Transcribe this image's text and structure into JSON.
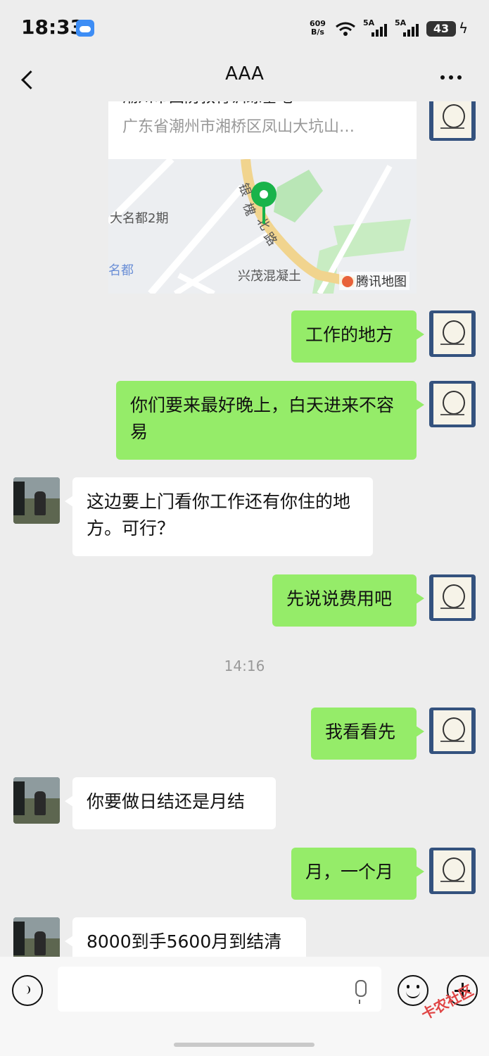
{
  "status_bar": {
    "time": "18:33",
    "net_speed_value": "609",
    "net_speed_unit": "B/s",
    "signal_1": "5A",
    "signal_2": "5A",
    "battery": "43"
  },
  "nav": {
    "title": "AAA"
  },
  "location_card": {
    "name": "潮州市国防教育训练基地",
    "address": "广东省潮州市湘桥区凤山大坑山…",
    "map_labels": [
      "大名都2期",
      "名都",
      "兴茂混凝土",
      "银",
      "槐",
      "北",
      "路"
    ],
    "map_brand": "腾讯地图"
  },
  "messages": [
    {
      "side": "me",
      "text": "工作的地方"
    },
    {
      "side": "me",
      "text": "你们要来最好晚上，白天进来不容易"
    },
    {
      "side": "other",
      "text": "这边要上门看你工作还有你住的地方。可行？"
    },
    {
      "side": "me",
      "text": "先说说费用吧"
    },
    {
      "side": "me",
      "text": "我看看先"
    },
    {
      "side": "other",
      "text": "你要做日结还是月结"
    },
    {
      "side": "me",
      "text": "月，一个月"
    },
    {
      "side": "other",
      "text": "8000到手5600月到结清"
    }
  ],
  "timestamp": "14:16",
  "input": {
    "placeholder": ""
  },
  "watermark": "卡农社区",
  "colors": {
    "background": "#ededed",
    "my_bubble": "#95ec69",
    "other_bubble": "#ffffff",
    "map_pin": "#19b34a"
  }
}
